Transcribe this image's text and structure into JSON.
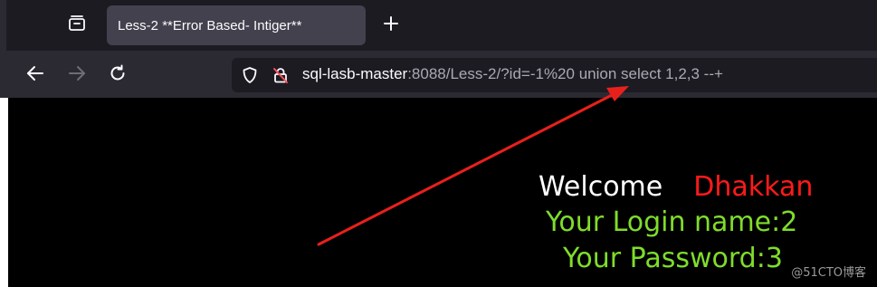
{
  "tabstrip": {
    "tab_title": "Less-2 **Error Based- Intiger**",
    "icons": {
      "overview": "tab-overview-icon",
      "new_tab": "plus-icon"
    }
  },
  "navbar": {
    "icons": {
      "back": "arrow-left-icon",
      "forward": "arrow-right-icon",
      "reload": "reload-icon",
      "shield": "shield-icon",
      "insecure": "insecure-lock-icon"
    },
    "url_host": "sql-lasb-master",
    "url_rest": ":8088/Less-2/?id=-1%20 union select 1,2,3 --+"
  },
  "page": {
    "welcome_word": "Welcome",
    "welcome_name": "Dhakkan",
    "login_line": "Your Login name:2",
    "password_line": "Your Password:3",
    "watermark": "@51CTO博客"
  },
  "colors": {
    "page_background": "#000000",
    "welcome": "#ffffff",
    "name": "#ff1a1a",
    "result_text": "#7fdd2a",
    "annotation_arrow": "#e8201c"
  },
  "annotation": {
    "type": "arrow",
    "points_to": "url-text"
  }
}
